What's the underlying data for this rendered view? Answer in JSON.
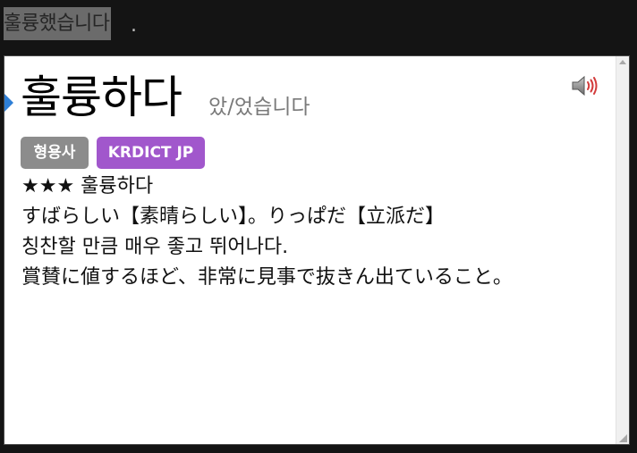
{
  "selection": {
    "text": "훌륭했습니다",
    "trailing": "."
  },
  "entry": {
    "headword": "훌륭하다",
    "conjugation": "았/었습니다",
    "pos_tag": "형용사",
    "dict_tag": "KRDICT JP",
    "stars_line": "★★★ 훌륭하다",
    "jp_gloss": "すばらしい【素晴らしい】。りっぱだ【立派だ】",
    "ko_definition": "칭찬할 만큼 매우 좋고 뛰어나다.",
    "jp_definition": "賞賛に値するほど、非常に見事で抜きん出ていること。"
  },
  "icons": {
    "marker": "entry-marker-icon",
    "audio": "speaker-icon"
  },
  "colors": {
    "pos_tag_bg": "#8c8c8c",
    "dict_tag_bg": "#a157cc",
    "marker": "#2e7fd6"
  }
}
